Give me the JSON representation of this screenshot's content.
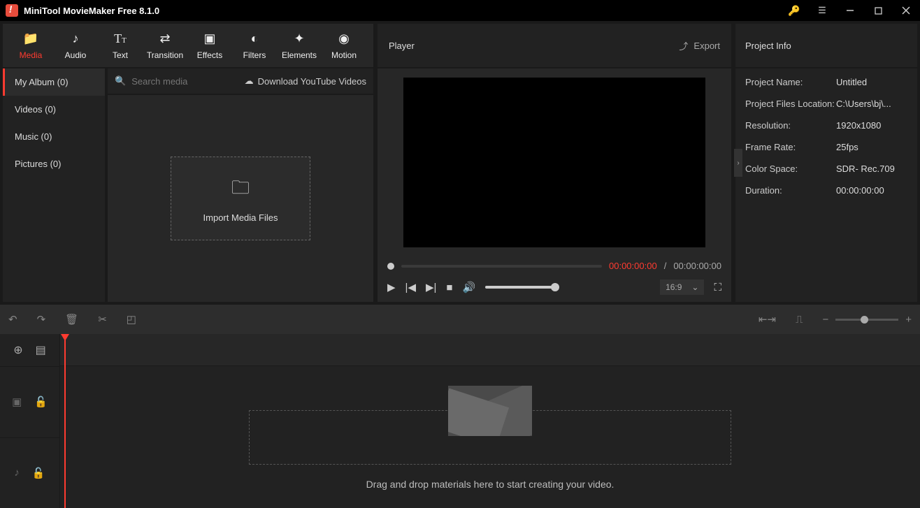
{
  "titlebar": {
    "title": "MiniTool MovieMaker Free 8.1.0"
  },
  "ribbon": [
    {
      "label": "Media",
      "active": true
    },
    {
      "label": "Audio",
      "active": false
    },
    {
      "label": "Text",
      "active": false
    },
    {
      "label": "Transition",
      "active": false
    },
    {
      "label": "Effects",
      "active": false
    },
    {
      "label": "Filters",
      "active": false
    },
    {
      "label": "Elements",
      "active": false
    },
    {
      "label": "Motion",
      "active": false
    }
  ],
  "sidebar": [
    {
      "label": "My Album (0)",
      "active": true
    },
    {
      "label": "Videos (0)",
      "active": false
    },
    {
      "label": "Music (0)",
      "active": false
    },
    {
      "label": "Pictures (0)",
      "active": false
    }
  ],
  "mediahead": {
    "search_placeholder": "Search media",
    "yt_label": "Download YouTube Videos"
  },
  "import_label": "Import Media Files",
  "player": {
    "title": "Player",
    "export_label": "Export",
    "time_current": "00:00:00:00",
    "time_sep": " / ",
    "time_total": "00:00:00:00",
    "ratio": "16:9"
  },
  "info": {
    "title": "Project Info",
    "rows": [
      {
        "k": "Project Name:",
        "v": "Untitled"
      },
      {
        "k": "Project Files Location:",
        "v": "C:\\Users\\bj\\..."
      },
      {
        "k": "Resolution:",
        "v": "1920x1080"
      },
      {
        "k": "Frame Rate:",
        "v": "25fps"
      },
      {
        "k": "Color Space:",
        "v": "SDR- Rec.709"
      },
      {
        "k": "Duration:",
        "v": "00:00:00:00"
      }
    ]
  },
  "timeline": {
    "drop_text": "Drag and drop materials here to start creating your video."
  }
}
